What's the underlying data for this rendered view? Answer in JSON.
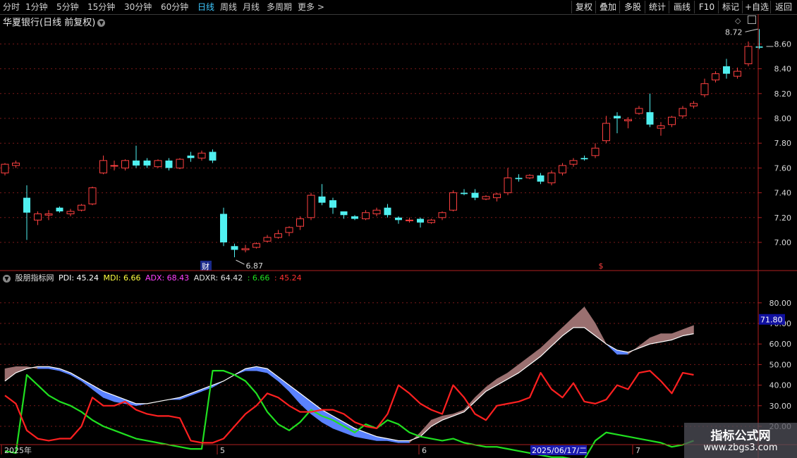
{
  "toolbar": {
    "periods": [
      "分时",
      "1分钟",
      "5分钟",
      "15分钟",
      "30分钟",
      "60分钟",
      "日线",
      "周线",
      "月线",
      "多周期",
      "更多 >"
    ],
    "active_period": "日线",
    "right_buttons": [
      "复权",
      "叠加",
      "多股",
      "统计",
      "画线",
      "F10",
      "标记",
      "+自选",
      "返回"
    ]
  },
  "stock": {
    "title": "华夏银行(日线 前复权)"
  },
  "price_axis": {
    "ticks": [
      "8.60",
      "8.40",
      "8.20",
      "8.00",
      "7.80",
      "7.60",
      "7.40",
      "7.20",
      "7.00"
    ]
  },
  "annotations": {
    "high_label": "8.72",
    "low_label": "6.87",
    "cai_marker": "财",
    "dollar_marker": "$"
  },
  "indicator": {
    "name": "股朋指标网",
    "pdi_label": "PDI: 45.24",
    "mdi_label": "MDI: 6.66",
    "adx_label": "ADX: 68.43",
    "adxr_label": "ADXR: 64.42",
    "val1": ": 6.66",
    "val2": ": 45.24",
    "axis_ticks": [
      "80.00",
      "70.00",
      "60.00",
      "50.00",
      "40.00",
      "30.00",
      "20.00"
    ],
    "cursor_value": "71.80",
    "colors": {
      "pdi": "#ff2020",
      "mdi": "#20e020",
      "adx": "#ffffff",
      "up": "#ff4040",
      "down": "#50f0f0",
      "cloud_brown": "#9a7070",
      "cloud_blue": "#5a82ff"
    }
  },
  "time_axis": {
    "labels": [
      "2025年",
      "5",
      "6",
      "7"
    ],
    "cursor_date": "2025/06/17/二"
  },
  "watermark": {
    "line1": "指标公式网",
    "line2": "www.zbgs3.com"
  },
  "chart_data": {
    "type": "candlestick",
    "candles": [
      [
        7.56,
        7.63,
        7.64,
        7.54
      ],
      [
        7.62,
        7.64,
        7.66,
        7.6
      ],
      [
        7.36,
        7.24,
        7.46,
        7.02
      ],
      [
        7.18,
        7.23,
        7.25,
        7.14
      ],
      [
        7.22,
        7.23,
        7.26,
        7.18
      ],
      [
        7.28,
        7.25,
        7.29,
        7.24
      ],
      [
        7.23,
        7.25,
        7.27,
        7.21
      ],
      [
        7.26,
        7.3,
        7.31,
        7.25
      ],
      [
        7.31,
        7.44,
        7.45,
        7.3
      ],
      [
        7.56,
        7.66,
        7.7,
        7.55
      ],
      [
        7.62,
        7.62,
        7.66,
        7.58
      ],
      [
        7.6,
        7.66,
        7.67,
        7.58
      ],
      [
        7.66,
        7.62,
        7.78,
        7.6
      ],
      [
        7.66,
        7.62,
        7.68,
        7.6
      ],
      [
        7.61,
        7.66,
        7.67,
        7.6
      ],
      [
        7.66,
        7.6,
        7.68,
        7.58
      ],
      [
        7.6,
        7.67,
        7.68,
        7.59
      ],
      [
        7.7,
        7.68,
        7.73,
        7.65
      ],
      [
        7.68,
        7.72,
        7.74,
        7.66
      ],
      [
        7.73,
        7.66,
        7.75,
        7.64
      ],
      [
        7.23,
        7.0,
        7.28,
        6.97
      ],
      [
        6.97,
        6.94,
        6.99,
        6.88
      ],
      [
        6.94,
        6.95,
        6.98,
        6.92
      ],
      [
        6.96,
        6.99,
        7.0,
        6.95
      ],
      [
        7.01,
        7.04,
        7.06,
        7.0
      ],
      [
        7.04,
        7.07,
        7.1,
        7.03
      ],
      [
        7.08,
        7.12,
        7.13,
        7.05
      ],
      [
        7.13,
        7.19,
        7.21,
        7.1
      ],
      [
        7.2,
        7.38,
        7.4,
        7.18
      ],
      [
        7.37,
        7.32,
        7.47,
        7.3
      ],
      [
        7.34,
        7.28,
        7.36,
        7.23
      ],
      [
        7.25,
        7.22,
        7.24,
        7.19
      ],
      [
        7.21,
        7.19,
        7.22,
        7.18
      ],
      [
        7.19,
        7.24,
        7.26,
        7.18
      ],
      [
        7.23,
        7.26,
        7.28,
        7.21
      ],
      [
        7.28,
        7.22,
        7.31,
        7.2
      ],
      [
        7.2,
        7.18,
        7.21,
        7.15
      ],
      [
        7.18,
        7.18,
        7.2,
        7.16
      ],
      [
        7.19,
        7.16,
        7.2,
        7.12
      ],
      [
        7.16,
        7.18,
        7.19,
        7.15
      ],
      [
        7.2,
        7.24,
        7.25,
        7.18
      ],
      [
        7.26,
        7.4,
        7.42,
        7.25
      ],
      [
        7.4,
        7.39,
        7.43,
        7.38
      ],
      [
        7.4,
        7.36,
        7.43,
        7.34
      ],
      [
        7.35,
        7.37,
        7.38,
        7.34
      ],
      [
        7.36,
        7.39,
        7.4,
        7.33
      ],
      [
        7.4,
        7.52,
        7.6,
        7.38
      ],
      [
        7.52,
        7.51,
        7.55,
        7.49
      ],
      [
        7.52,
        7.54,
        7.55,
        7.51
      ],
      [
        7.54,
        7.49,
        7.56,
        7.47
      ],
      [
        7.48,
        7.56,
        7.58,
        7.46
      ],
      [
        7.56,
        7.62,
        7.64,
        7.54
      ],
      [
        7.63,
        7.66,
        7.68,
        7.61
      ],
      [
        7.68,
        7.67,
        7.7,
        7.66
      ],
      [
        7.7,
        7.76,
        7.8,
        7.68
      ],
      [
        7.82,
        7.96,
        8.02,
        7.8
      ],
      [
        8.02,
        8.0,
        8.05,
        7.88
      ],
      [
        7.98,
        7.99,
        8.01,
        7.92
      ],
      [
        8.04,
        8.08,
        8.1,
        8.03
      ],
      [
        8.05,
        7.95,
        8.2,
        7.93
      ],
      [
        7.92,
        7.94,
        7.97,
        7.86
      ],
      [
        7.95,
        8.01,
        8.02,
        7.93
      ],
      [
        8.02,
        8.08,
        8.1,
        8.0
      ],
      [
        8.1,
        8.12,
        8.14,
        8.08
      ],
      [
        8.19,
        8.28,
        8.32,
        8.17
      ],
      [
        8.31,
        8.36,
        8.38,
        8.29
      ],
      [
        8.42,
        8.36,
        8.48,
        8.32
      ],
      [
        8.34,
        8.38,
        8.41,
        8.32
      ],
      [
        8.44,
        8.58,
        8.62,
        8.42
      ],
      [
        8.58,
        8.57,
        8.72,
        8.56
      ]
    ],
    "pdi": [
      35,
      31,
      18,
      14,
      13,
      14,
      14,
      20,
      34,
      30,
      30,
      32,
      28,
      26,
      25,
      25,
      24,
      13,
      12,
      12,
      14,
      20,
      26,
      30,
      36,
      34,
      30,
      27,
      27,
      28,
      28,
      26,
      22,
      20,
      19,
      26,
      40,
      36,
      31,
      28,
      26,
      40,
      34,
      26,
      23,
      30,
      31,
      32,
      34,
      46,
      38,
      34,
      41,
      32,
      31,
      33,
      40,
      38,
      46,
      47,
      42,
      36,
      46,
      45
    ],
    "mdi": [
      8,
      7,
      45,
      40,
      35,
      32,
      30,
      27,
      23,
      20,
      18,
      16,
      14,
      13,
      12,
      11,
      10,
      9,
      9,
      47,
      47,
      45,
      42,
      36,
      27,
      21,
      18,
      22,
      28,
      25,
      23,
      20,
      17,
      21,
      19,
      23,
      21,
      17,
      15,
      14,
      13,
      14,
      12,
      11,
      10,
      10,
      9,
      8,
      7,
      6,
      5,
      5,
      4,
      4,
      13,
      17,
      16,
      15,
      14,
      13,
      12,
      10,
      11,
      13
    ],
    "adx": [
      42,
      46,
      48,
      49,
      49,
      48,
      46,
      43,
      40,
      37,
      35,
      33,
      31,
      31,
      32,
      33,
      34,
      36,
      38,
      40,
      42,
      45,
      48,
      49,
      48,
      44,
      40,
      36,
      32,
      28,
      25,
      22,
      19,
      17,
      15,
      14,
      13,
      13,
      15,
      20,
      23,
      25,
      27,
      32,
      37,
      40,
      43,
      46,
      50,
      54,
      59,
      64,
      68,
      68,
      64,
      60,
      57,
      56,
      58,
      60,
      61,
      62,
      64,
      65
    ],
    "adxr": [
      48,
      49,
      49,
      48,
      48,
      47,
      45,
      42,
      38,
      34,
      32,
      31,
      30,
      31,
      32,
      33,
      33,
      35,
      37,
      39,
      42,
      45,
      47,
      47,
      46,
      42,
      37,
      31,
      26,
      22,
      19,
      17,
      15,
      14,
      13,
      13,
      12,
      12,
      17,
      23,
      25,
      26,
      28,
      34,
      39,
      43,
      46,
      50,
      54,
      58,
      63,
      68,
      73,
      78,
      70,
      60,
      55,
      55,
      59,
      63,
      65,
      65,
      67,
      69
    ]
  }
}
